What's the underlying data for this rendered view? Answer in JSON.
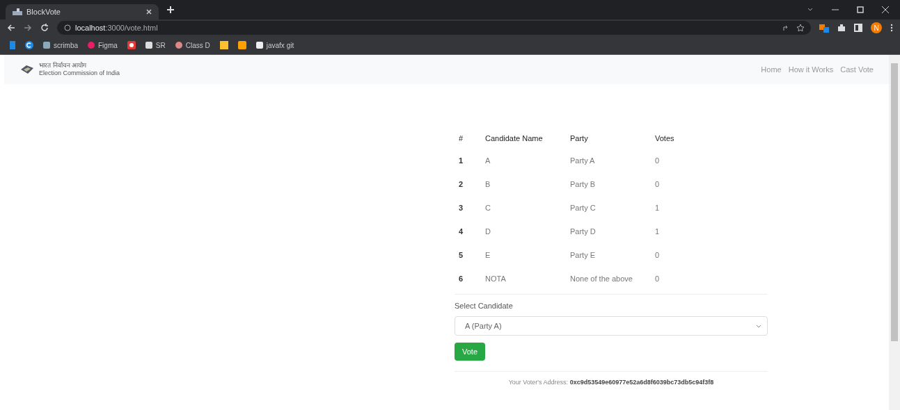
{
  "browser": {
    "tabs": [
      {
        "title": "BlockVote",
        "selected": true
      }
    ],
    "address": {
      "host": "localhost",
      "path": ":3000/vote.html"
    },
    "bookmarks": [
      {
        "label": "scrimba"
      },
      {
        "label": "Figma"
      },
      {
        "label": "SR"
      },
      {
        "label": "Class D"
      },
      {
        "label": "javafx git"
      }
    ],
    "profile": "N"
  },
  "navbar": {
    "brand": {
      "line1": "भारत निर्वाचन आयोग",
      "line2": "Election Commission of India"
    },
    "links": [
      "Home",
      "How it Works",
      "Cast Vote"
    ]
  },
  "table": {
    "columns": [
      "#",
      "Candidate Name",
      "Party",
      "Votes"
    ],
    "rows": [
      [
        "1",
        "A",
        "Party A",
        "0"
      ],
      [
        "2",
        "B",
        "Party B",
        "0"
      ],
      [
        "3",
        "C",
        "Party C",
        "1"
      ],
      [
        "4",
        "D",
        "Party D",
        "1"
      ],
      [
        "5",
        "E",
        "Party E",
        "0"
      ],
      [
        "6",
        "NOTA",
        "None of the above",
        "0"
      ]
    ]
  },
  "form": {
    "label": "Select Candidate",
    "value": "A (Party A)",
    "button": "Vote"
  },
  "footer": {
    "label": "Your Voter's Address:",
    "address": "0xc9d53549e60977e52a6d8f6039bc73db5c94f3f8"
  }
}
